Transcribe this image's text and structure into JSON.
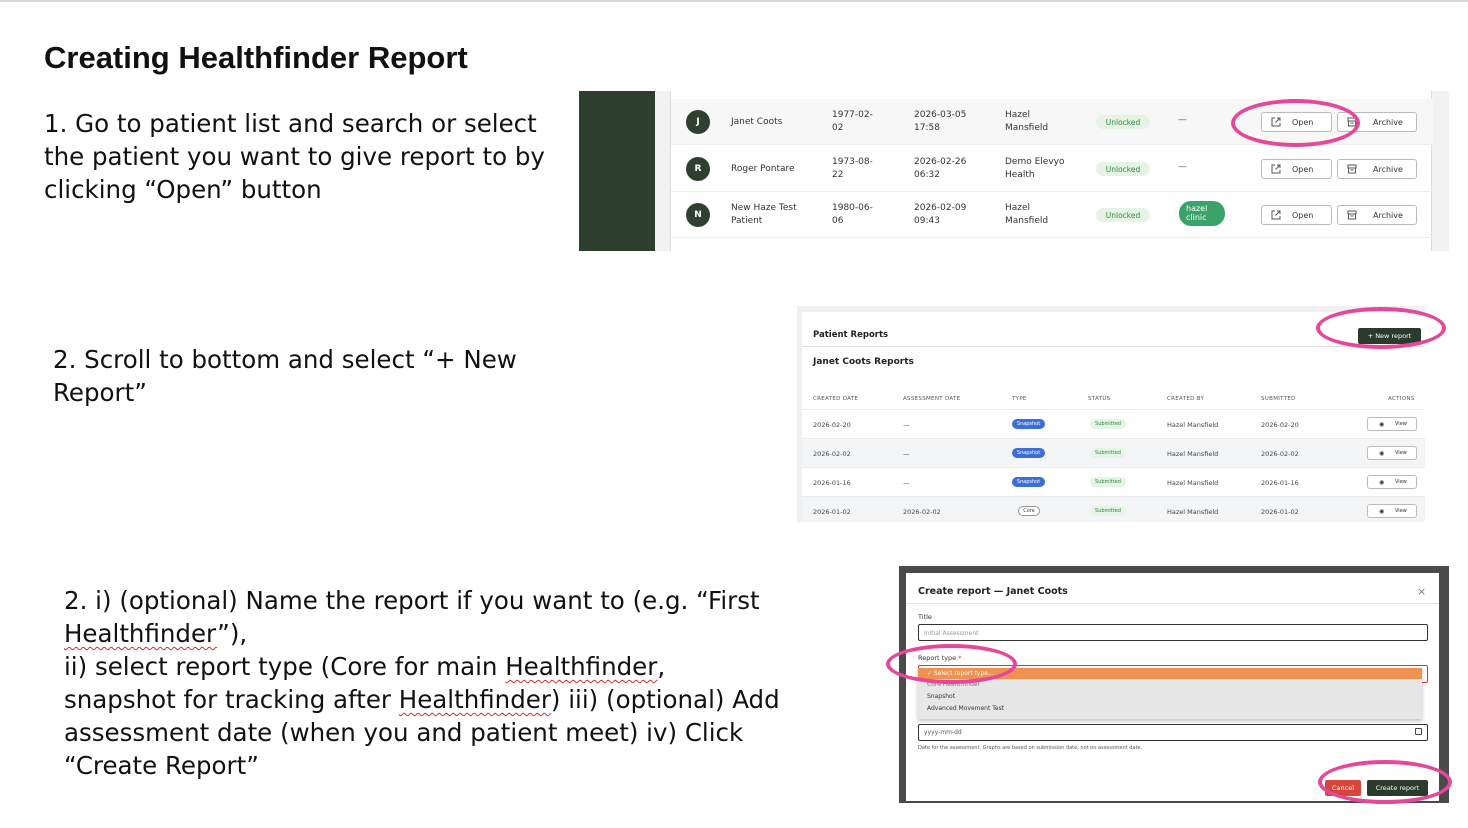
{
  "slide": {
    "title": "Creating Healthfinder Report",
    "step1": "1. Go to patient list and search or select the patient you want to give report to by clicking “Open” button",
    "step2": "2. Scroll to bottom and select “+ New Report”",
    "step3": {
      "p1": "2. i) (optional) Name the report if you want to (e.g. “First ",
      "p2": "Healthfinder",
      "p3": "”),",
      "p4": "ii) select report type (Core for main ",
      "p5": "Healthfinder",
      "p6": ", snapshot for tracking after ",
      "p7": "Healthfinder",
      "p8": ") iii) (optional) Add assessment date (when you and patient meet) iv) Click “Create Report”"
    }
  },
  "patient_list": {
    "open_label": "Open",
    "archive_label": "Archive",
    "rows": [
      {
        "initial": "J",
        "name": "Janet Coots",
        "dob": "1977-02-\n02",
        "registered": "2026-03-05\n17:58",
        "clinic": "Hazel\nMansfield",
        "status": "Unlocked",
        "tag": "—"
      },
      {
        "initial": "R",
        "name": "Roger Pontare",
        "dob": "1973-08-\n22",
        "registered": "2026-02-26\n06:32",
        "clinic": "Demo Elevyo\nHealth",
        "status": "Unlocked",
        "tag": "—"
      },
      {
        "initial": "N",
        "name": "New Haze Test\nPatient",
        "dob": "1980-06-\n06",
        "registered": "2026-02-09\n09:43",
        "clinic": "Hazel\nMansfield",
        "status": "Unlocked",
        "tag": "hazel\nclinic"
      }
    ]
  },
  "patient_reports": {
    "section_title": "Patient Reports",
    "new_report_label": "+ New report",
    "card_title": "Janet Coots Reports",
    "columns": [
      "CREATED DATE",
      "ASSESSMENT DATE",
      "TYPE",
      "STATUS",
      "CREATED BY",
      "SUBMITTED",
      "ACTIONS"
    ],
    "view_label": "View",
    "rows": [
      {
        "created": "2026-02-20",
        "assessment": "—",
        "type": "Snapshot",
        "status": "Submitted",
        "by": "Hazel Mansfield",
        "submitted": "2026-02-20"
      },
      {
        "created": "2026-02-02",
        "assessment": "—",
        "type": "Snapshot",
        "status": "Submitted",
        "by": "Hazel Mansfield",
        "submitted": "2026-02-02"
      },
      {
        "created": "2026-01-16",
        "assessment": "—",
        "type": "Snapshot",
        "status": "Submitted",
        "by": "Hazel Mansfield",
        "submitted": "2026-01-16"
      },
      {
        "created": "2026-01-02",
        "assessment": "2026-02-02",
        "type": "Core",
        "status": "Submitted",
        "by": "Hazel Mansfield",
        "submitted": "2026-01-02"
      }
    ]
  },
  "create_dialog": {
    "title": "Create report — Janet Coots",
    "close_glyph": "×",
    "title_label": "Title",
    "title_placeholder": "Initial Assessment",
    "type_label": "Report type",
    "required_mark": "*",
    "options": [
      "✓ Select report type...",
      "Core Healthfinder",
      "Snapshot",
      "Advanced Movement Test"
    ],
    "date_placeholder": "yyyy-mm-dd",
    "date_hint": "Date for the assessment. Graphs are based on submission date, not on assessment date.",
    "cancel_label": "Cancel",
    "create_label": "Create report"
  },
  "colors": {
    "highlight": "#e5489a",
    "sidebar_dark": "#2d3e2d",
    "primary_button": "#2a3a2c",
    "cancel_button": "#d8453a",
    "selected_option": "#ef9150"
  }
}
